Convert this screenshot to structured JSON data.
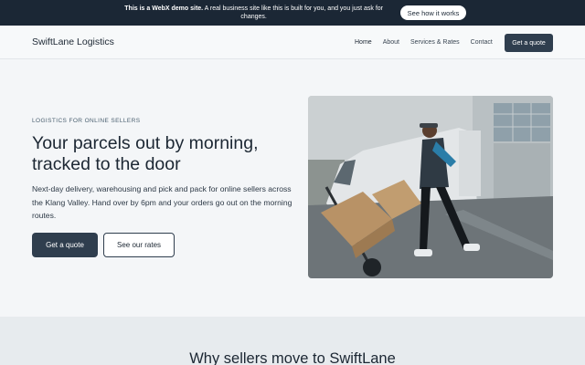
{
  "announcement": {
    "bold": "This is a WebX demo site.",
    "text": " A real business site like this is built for you, and you just ask for changes.",
    "button": "See how it works"
  },
  "header": {
    "brand": "SwiftLane Logistics",
    "nav": [
      "Home",
      "About",
      "Services & Rates",
      "Contact"
    ],
    "active_nav": "Home",
    "cta": "Get a quote"
  },
  "hero": {
    "eyebrow": "LOGISTICS FOR ONLINE SELLERS",
    "headline": "Your parcels out by morning, tracked to the door",
    "subcopy": "Next-day delivery, warehousing and pick and pack for online sellers across the Klang Valley. Hand over by 6pm and your orders go out on the morning routes.",
    "primary_button": "Get a quote",
    "secondary_button": "See our rates"
  },
  "section": {
    "title": "Why sellers move to SwiftLane"
  },
  "colors": {
    "dark_navy": "#1b2735",
    "button_slate": "#2f3e4e",
    "page_bg": "#f4f6f8",
    "section_bg": "#e7ebee"
  }
}
